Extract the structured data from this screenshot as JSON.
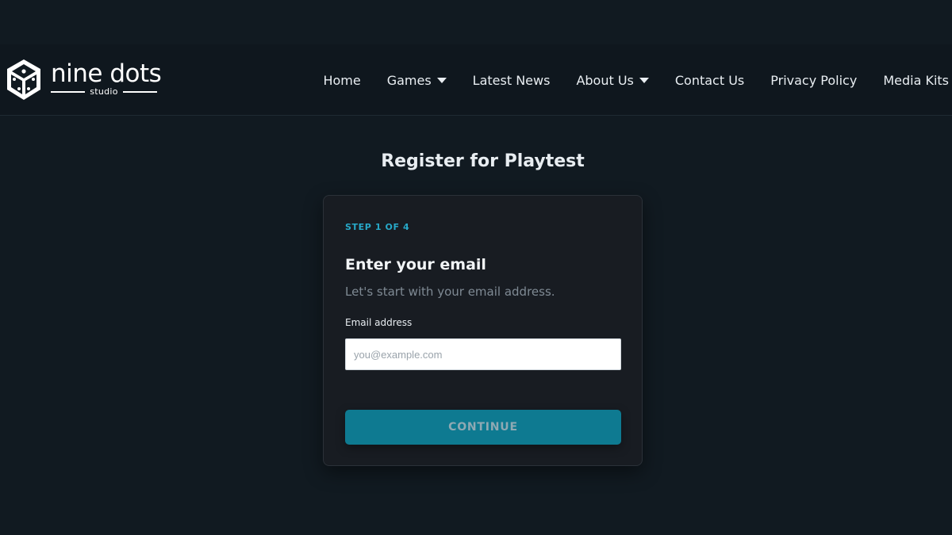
{
  "header": {
    "logo": {
      "name": "nine dots",
      "sub": "studio"
    },
    "nav": [
      {
        "label": "Home",
        "dropdown": false
      },
      {
        "label": "Games",
        "dropdown": true
      },
      {
        "label": "Latest News",
        "dropdown": false
      },
      {
        "label": "About Us",
        "dropdown": true
      },
      {
        "label": "Contact Us",
        "dropdown": false
      },
      {
        "label": "Privacy Policy",
        "dropdown": false
      },
      {
        "label": "Media Kits",
        "dropdown": false
      }
    ]
  },
  "main": {
    "title": "Register for Playtest",
    "card": {
      "step": "STEP 1 OF 4",
      "heading": "Enter your email",
      "subheading": "Let's start with your email address.",
      "email_label": "Email address",
      "email_placeholder": "you@example.com",
      "email_value": "",
      "continue_label": "CONTINUE"
    }
  },
  "colors": {
    "background": "#111a21",
    "accent": "#27a9c9",
    "button": "#0e7a91"
  },
  "icons": [
    "dice-logo-icon",
    "caret-down-icon"
  ]
}
